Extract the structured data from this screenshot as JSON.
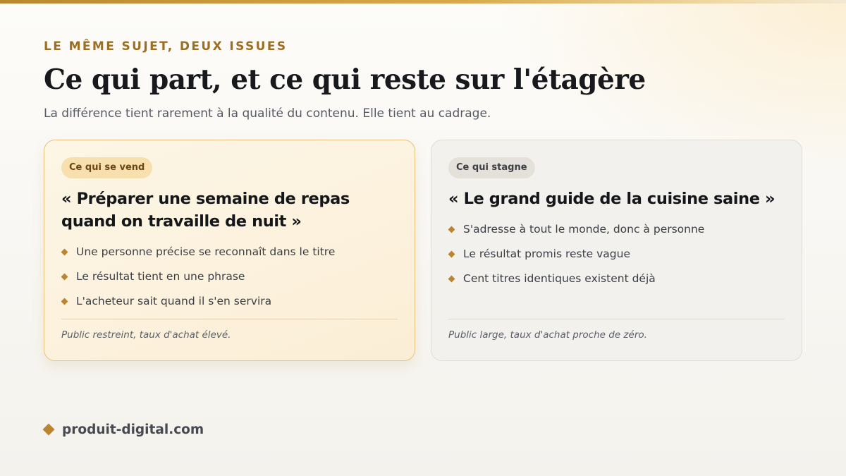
{
  "header": {
    "eyebrow": "LE MÊME SUJET, DEUX ISSUES",
    "title": "Ce qui part, et ce qui reste sur l'étagère",
    "subtitle": "La différence tient rarement à la qualité du contenu. Elle tient au cadrage."
  },
  "cards": [
    {
      "badge": "Ce qui se vend",
      "title": "« Préparer une semaine de repas quand on travaille de nuit »",
      "points": [
        "Une personne précise se reconnaît dans le titre",
        "Le résultat tient en une phrase",
        "L'acheteur sait quand il s'en servira"
      ],
      "note": "Public restreint, taux d'achat élevé."
    },
    {
      "badge": "Ce qui stagne",
      "title": "« Le grand guide de la cuisine saine »",
      "points": [
        "S'adresse à tout le monde, donc à personne",
        "Le résultat promis reste vague",
        "Cent titres identiques existent déjà"
      ],
      "note": "Public large, taux d'achat proche de zéro."
    }
  ],
  "footer": {
    "brand": "produit-digital.com"
  },
  "colors": {
    "accent": "#b98530",
    "eyebrow": "#9c6e22",
    "left_card_border": "#e7c47e",
    "left_badge": "#f7dfae",
    "right_badge": "#e4e1da"
  },
  "icons": {
    "bullet": "diamond-bullet-icon",
    "brand": "diamond-logo-icon"
  }
}
